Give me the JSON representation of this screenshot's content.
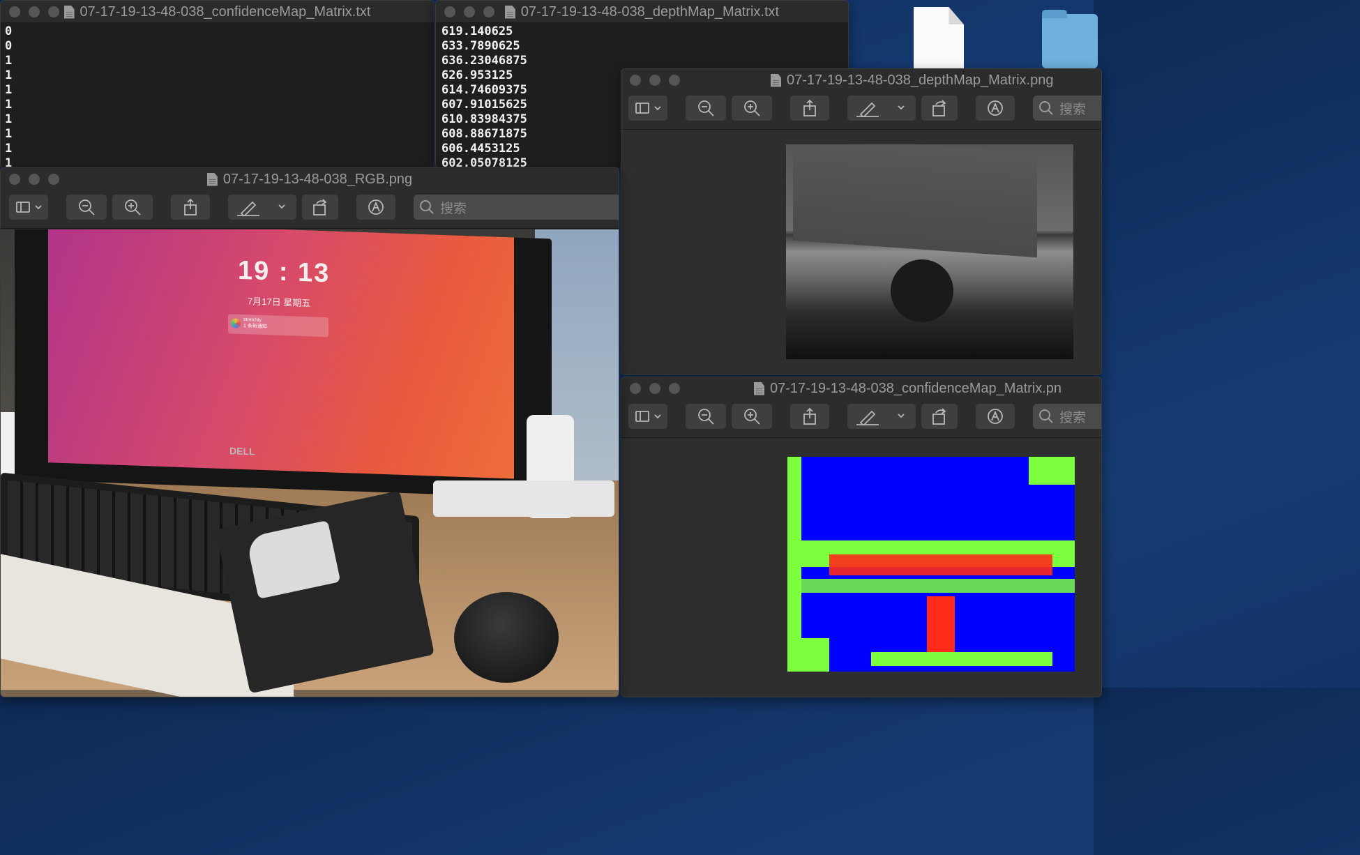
{
  "desktop": {
    "file_icon": "document-icon",
    "folder_icon": "folder-icon"
  },
  "windows": {
    "confidence_txt": {
      "title": "07-17-19-13-48-038_confidenceMap_Matrix.txt",
      "lines": [
        "0",
        "0",
        "1",
        "1",
        "1",
        "1",
        "1",
        "1",
        "1",
        "1"
      ]
    },
    "depth_txt": {
      "title": "07-17-19-13-48-038_depthMap_Matrix.txt",
      "lines": [
        "619.140625",
        "633.7890625",
        "636.23046875",
        "626.953125",
        "614.74609375",
        "607.91015625",
        "610.83984375",
        "608.88671875",
        "606.4453125",
        "602.05078125"
      ]
    },
    "rgb_png": {
      "title": "07-17-19-13-48-038_RGB.png",
      "search_placeholder": "搜索",
      "photo": {
        "clock": "19 : 13",
        "date": "7月17日 星期五",
        "notification_app": "stretchly",
        "notification_text": "1 条新通知",
        "monitor_brand": "DELL"
      }
    },
    "depth_png": {
      "title": "07-17-19-13-48-038_depthMap_Matrix.png",
      "search_placeholder": "搜索"
    },
    "confidence_png": {
      "title": "07-17-19-13-48-038_confidenceMap_Matrix.pn",
      "search_placeholder": "搜索",
      "colors": {
        "high": "#0000ff",
        "medium": "#7cff3c",
        "low": "#ff2a1a"
      }
    }
  },
  "toolbar_icons": [
    "sidebar-icon",
    "zoom-out-icon",
    "zoom-in-icon",
    "share-icon",
    "markup-pen-icon",
    "rotate-icon",
    "annotate-icon",
    "search-icon"
  ]
}
